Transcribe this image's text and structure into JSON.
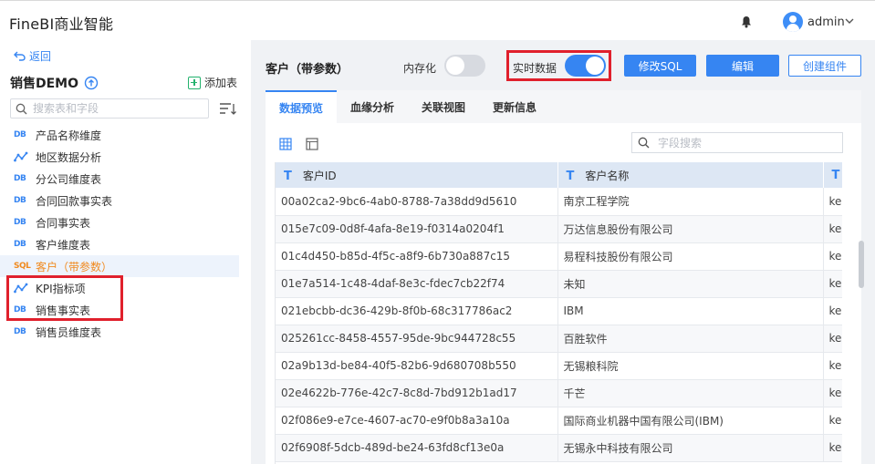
{
  "header": {
    "app_title": "FineBI商业智能",
    "user": "admin"
  },
  "sidebar": {
    "back_label": "返回",
    "package_title": "销售DEMO",
    "add_table_label": "添加表",
    "search_placeholder": "搜索表和字段",
    "items": [
      {
        "label": "产品名称维度",
        "icon": "DB"
      },
      {
        "label": "地区数据分析",
        "icon": "analysis"
      },
      {
        "label": "分公司维度表",
        "icon": "DB"
      },
      {
        "label": "合同回款事实表",
        "icon": "DB"
      },
      {
        "label": "合同事实表",
        "icon": "DB"
      },
      {
        "label": "客户维度表",
        "icon": "DB"
      },
      {
        "label": "客户（带参数）",
        "icon": "SQL",
        "selected": true
      },
      {
        "label": "KPI指标项",
        "icon": "analysis"
      },
      {
        "label": "销售事实表",
        "icon": "DB"
      },
      {
        "label": "销售员维度表",
        "icon": "DB"
      }
    ]
  },
  "main": {
    "title": "客户（带参数）",
    "memory_label": "内存化",
    "memory_on": false,
    "realtime_label": "实时数据",
    "realtime_on": true,
    "buttons": {
      "edit_sql": "修改SQL",
      "edit": "编辑",
      "create_component": "创建组件"
    },
    "tabs": [
      "数据预览",
      "血缘分析",
      "关联视图",
      "更新信息"
    ],
    "active_tab": 0,
    "field_search_placeholder": "字段搜索",
    "columns": [
      "客户ID",
      "客户名称",
      ""
    ],
    "rows": [
      [
        "00a02ca2-9bc6-4ab0-8788-7a38dd9d5610",
        "南京工程学院",
        "kel"
      ],
      [
        "015e7c09-0d8f-4afa-8e19-f0314a0204f1",
        "万达信息股份有限公司",
        "kel"
      ],
      [
        "01c4d450-b85d-4f5c-a8f9-6b730a887c15",
        "易程科技股份有限公司",
        "kel"
      ],
      [
        "01e7a514-1c48-4daf-8e3c-fdec7cb22f74",
        "未知",
        "kel"
      ],
      [
        "021ebcbb-dc36-429b-8f0b-68c317786ac2",
        "IBM",
        "kel"
      ],
      [
        "025261cc-8458-4557-95de-9bc944728c55",
        "百胜软件",
        "kel"
      ],
      [
        "02a9b13d-be84-40f5-82b6-9d680708b550",
        "无锡粮科院",
        "kel"
      ],
      [
        "02e4622b-776e-42c7-8c8d-7bd912b1ad17",
        "千芒",
        "kel"
      ],
      [
        "02f086e9-e7ce-4607-ac70-e9f0b8a3a10a",
        "国际商业机器中国有限公司(IBM)",
        "kel"
      ],
      [
        "02f6908f-5dcb-489d-be24-63fd8cf13e0a",
        "无锡永中科技有限公司",
        "kel"
      ]
    ]
  },
  "colors": {
    "accent": "#3685f2",
    "highlight_box": "#e0202c",
    "selected_text": "#f08a1f"
  }
}
